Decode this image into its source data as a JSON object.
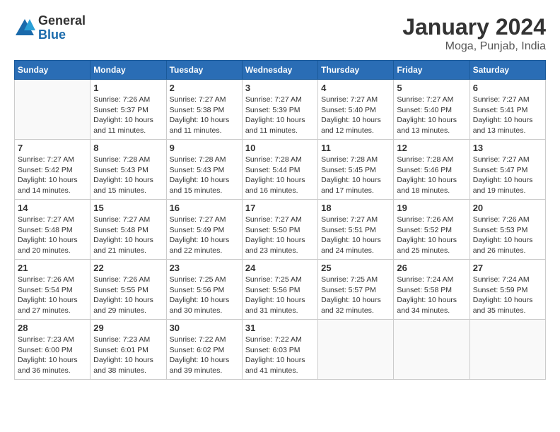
{
  "logo": {
    "general": "General",
    "blue": "Blue"
  },
  "title": "January 2024",
  "subtitle": "Moga, Punjab, India",
  "weekdays": [
    "Sunday",
    "Monday",
    "Tuesday",
    "Wednesday",
    "Thursday",
    "Friday",
    "Saturday"
  ],
  "weeks": [
    [
      {
        "day": "",
        "info": ""
      },
      {
        "day": "1",
        "info": "Sunrise: 7:26 AM\nSunset: 5:37 PM\nDaylight: 10 hours\nand 11 minutes."
      },
      {
        "day": "2",
        "info": "Sunrise: 7:27 AM\nSunset: 5:38 PM\nDaylight: 10 hours\nand 11 minutes."
      },
      {
        "day": "3",
        "info": "Sunrise: 7:27 AM\nSunset: 5:39 PM\nDaylight: 10 hours\nand 11 minutes."
      },
      {
        "day": "4",
        "info": "Sunrise: 7:27 AM\nSunset: 5:40 PM\nDaylight: 10 hours\nand 12 minutes."
      },
      {
        "day": "5",
        "info": "Sunrise: 7:27 AM\nSunset: 5:40 PM\nDaylight: 10 hours\nand 13 minutes."
      },
      {
        "day": "6",
        "info": "Sunrise: 7:27 AM\nSunset: 5:41 PM\nDaylight: 10 hours\nand 13 minutes."
      }
    ],
    [
      {
        "day": "7",
        "info": "Sunrise: 7:27 AM\nSunset: 5:42 PM\nDaylight: 10 hours\nand 14 minutes."
      },
      {
        "day": "8",
        "info": "Sunrise: 7:28 AM\nSunset: 5:43 PM\nDaylight: 10 hours\nand 15 minutes."
      },
      {
        "day": "9",
        "info": "Sunrise: 7:28 AM\nSunset: 5:43 PM\nDaylight: 10 hours\nand 15 minutes."
      },
      {
        "day": "10",
        "info": "Sunrise: 7:28 AM\nSunset: 5:44 PM\nDaylight: 10 hours\nand 16 minutes."
      },
      {
        "day": "11",
        "info": "Sunrise: 7:28 AM\nSunset: 5:45 PM\nDaylight: 10 hours\nand 17 minutes."
      },
      {
        "day": "12",
        "info": "Sunrise: 7:28 AM\nSunset: 5:46 PM\nDaylight: 10 hours\nand 18 minutes."
      },
      {
        "day": "13",
        "info": "Sunrise: 7:27 AM\nSunset: 5:47 PM\nDaylight: 10 hours\nand 19 minutes."
      }
    ],
    [
      {
        "day": "14",
        "info": "Sunrise: 7:27 AM\nSunset: 5:48 PM\nDaylight: 10 hours\nand 20 minutes."
      },
      {
        "day": "15",
        "info": "Sunrise: 7:27 AM\nSunset: 5:48 PM\nDaylight: 10 hours\nand 21 minutes."
      },
      {
        "day": "16",
        "info": "Sunrise: 7:27 AM\nSunset: 5:49 PM\nDaylight: 10 hours\nand 22 minutes."
      },
      {
        "day": "17",
        "info": "Sunrise: 7:27 AM\nSunset: 5:50 PM\nDaylight: 10 hours\nand 23 minutes."
      },
      {
        "day": "18",
        "info": "Sunrise: 7:27 AM\nSunset: 5:51 PM\nDaylight: 10 hours\nand 24 minutes."
      },
      {
        "day": "19",
        "info": "Sunrise: 7:26 AM\nSunset: 5:52 PM\nDaylight: 10 hours\nand 25 minutes."
      },
      {
        "day": "20",
        "info": "Sunrise: 7:26 AM\nSunset: 5:53 PM\nDaylight: 10 hours\nand 26 minutes."
      }
    ],
    [
      {
        "day": "21",
        "info": "Sunrise: 7:26 AM\nSunset: 5:54 PM\nDaylight: 10 hours\nand 27 minutes."
      },
      {
        "day": "22",
        "info": "Sunrise: 7:26 AM\nSunset: 5:55 PM\nDaylight: 10 hours\nand 29 minutes."
      },
      {
        "day": "23",
        "info": "Sunrise: 7:25 AM\nSunset: 5:56 PM\nDaylight: 10 hours\nand 30 minutes."
      },
      {
        "day": "24",
        "info": "Sunrise: 7:25 AM\nSunset: 5:56 PM\nDaylight: 10 hours\nand 31 minutes."
      },
      {
        "day": "25",
        "info": "Sunrise: 7:25 AM\nSunset: 5:57 PM\nDaylight: 10 hours\nand 32 minutes."
      },
      {
        "day": "26",
        "info": "Sunrise: 7:24 AM\nSunset: 5:58 PM\nDaylight: 10 hours\nand 34 minutes."
      },
      {
        "day": "27",
        "info": "Sunrise: 7:24 AM\nSunset: 5:59 PM\nDaylight: 10 hours\nand 35 minutes."
      }
    ],
    [
      {
        "day": "28",
        "info": "Sunrise: 7:23 AM\nSunset: 6:00 PM\nDaylight: 10 hours\nand 36 minutes."
      },
      {
        "day": "29",
        "info": "Sunrise: 7:23 AM\nSunset: 6:01 PM\nDaylight: 10 hours\nand 38 minutes."
      },
      {
        "day": "30",
        "info": "Sunrise: 7:22 AM\nSunset: 6:02 PM\nDaylight: 10 hours\nand 39 minutes."
      },
      {
        "day": "31",
        "info": "Sunrise: 7:22 AM\nSunset: 6:03 PM\nDaylight: 10 hours\nand 41 minutes."
      },
      {
        "day": "",
        "info": ""
      },
      {
        "day": "",
        "info": ""
      },
      {
        "day": "",
        "info": ""
      }
    ]
  ]
}
